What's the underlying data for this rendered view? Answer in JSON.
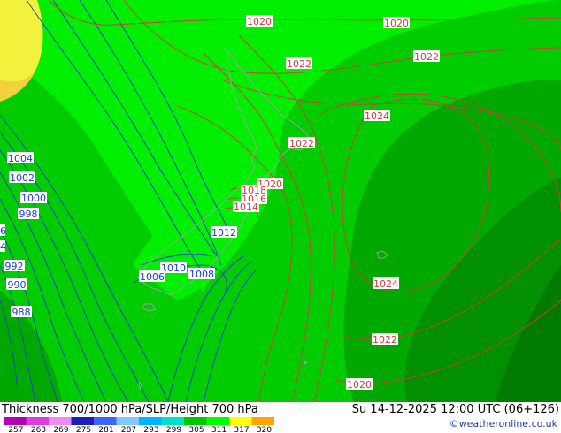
{
  "title": "Thickness 700/1000 hPa/SLP/Height 700 hPa",
  "valid_time": "Su 14-12-2025 12:00 UTC (06+126)",
  "credit": "©weatheronline.co.uk",
  "legend": {
    "values": [
      "257",
      "263",
      "269",
      "275",
      "281",
      "287",
      "293",
      "299",
      "305",
      "311",
      "317",
      "320"
    ],
    "colors": [
      "#b400b4",
      "#e13ce1",
      "#f08cf0",
      "#1e1eb4",
      "#3c64ff",
      "#82c8ff",
      "#00b4ff",
      "#00e1c8",
      "#00c800",
      "#00ff00",
      "#ffff00",
      "#ffa500"
    ]
  },
  "shading_colors": {
    "bright_green": "#00ee00",
    "mid_green": "#00cc00",
    "dark_green": "#00a800",
    "darker_green": "#009000",
    "darkest_green": "#007a00",
    "yellow": "#f2f23c"
  },
  "isobars": {
    "red": [
      "1020",
      "1020",
      "1022",
      "1022",
      "1024",
      "1022",
      "1020",
      "1018",
      "1016",
      "1014",
      "1024",
      "1022",
      "1020"
    ],
    "blue": [
      "1004",
      "1002",
      "1000",
      "998",
      "992",
      "990",
      "988",
      "1012",
      "1010",
      "1008",
      "1006"
    ],
    "edge": [
      "6",
      "4"
    ]
  }
}
